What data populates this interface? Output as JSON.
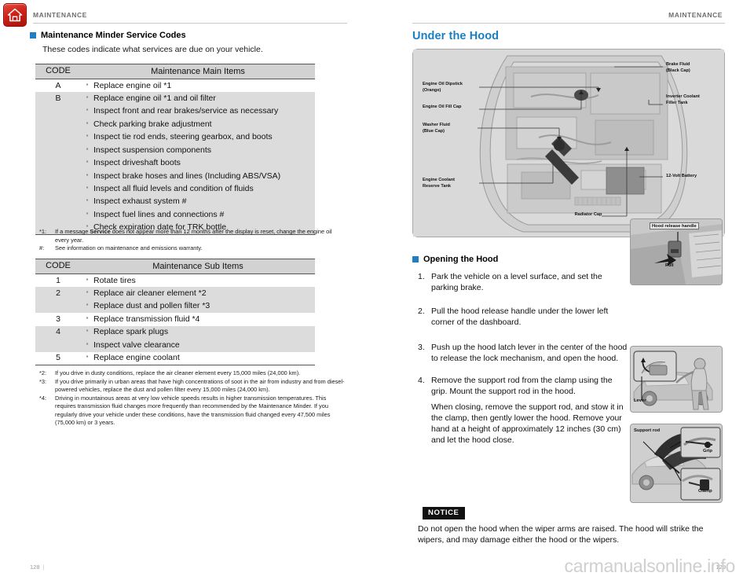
{
  "home_icon": {
    "name": "home-icon"
  },
  "left_page": {
    "running_head": "MAINTENANCE",
    "section_heading": "Maintenance Minder Service Codes",
    "lead": "These codes indicate what services are due on your vehicle.",
    "main_table": {
      "col_code": "CODE",
      "col_items": "Maintenance Main Items",
      "rows": [
        {
          "code": "A",
          "items": [
            "Replace engine oil *1"
          ]
        },
        {
          "code": "B",
          "items": [
            "Replace engine oil *1 and oil filter",
            "Inspect front and rear brakes/service as necessary",
            "Check parking brake adjustment",
            "Inspect tie rod ends, steering gearbox, and boots",
            "Inspect suspension components",
            "Inspect driveshaft boots",
            "Inspect brake hoses and lines (Including ABS/VSA)",
            "Inspect all fluid levels and condition of fluids",
            "Inspect exhaust system #",
            "Inspect fuel lines and connections #",
            "Check expiration date for TRK bottle"
          ]
        }
      ]
    },
    "main_footnotes": [
      {
        "key": "*1:",
        "text_before": "If a message ",
        "bold": "Service",
        "text_after": " does not appear more than 12 months after the display is reset, change the engine oil every year."
      },
      {
        "key": "#:",
        "text_before": "See information on maintenance and emissions warranty.",
        "bold": "",
        "text_after": ""
      }
    ],
    "sub_table": {
      "col_code": "CODE",
      "col_items": "Maintenance Sub Items",
      "rows": [
        {
          "code": "1",
          "items": [
            "Rotate tires"
          ]
        },
        {
          "code": "2",
          "items": [
            "Replace air cleaner element *2",
            "Replace dust and pollen filter  *3"
          ]
        },
        {
          "code": "3",
          "items": [
            "Replace transmission fluid *4"
          ]
        },
        {
          "code": "4",
          "items": [
            "Replace spark plugs",
            "Inspect valve clearance"
          ]
        },
        {
          "code": "5",
          "items": [
            "Replace engine coolant"
          ]
        }
      ]
    },
    "sub_footnotes": [
      {
        "key": "*2:",
        "text": "If you drive in dusty conditions, replace the air cleaner element every 15,000 miles (24,000 km)."
      },
      {
        "key": "*3:",
        "text": "If you drive primarily in urban areas that have high concentrations of soot in the air from industry and from diesel-powered vehicles, replace the dust and pollen filter every 15,000 miles (24,000 km)."
      },
      {
        "key": "*4:",
        "text": "Driving in mountainous areas at very low vehicle speeds results in higher transmission temperatures. This requires transmission fluid changes more frequently than recommended by the Maintenance Minder. If you regularly drive your vehicle under these conditions, have the transmission fluid changed every 47,500 miles (75,000 km) or 3 years."
      }
    ],
    "page_number": "128"
  },
  "right_page": {
    "running_head": "MAINTENANCE",
    "title": "Under the Hood",
    "engine_diagram": {
      "labels_left": [
        "Engine Oil Dipstick\n(Orange)",
        "Engine Oil Fill Cap",
        "Washer Fluid\n(Blue Cap)",
        "Engine Coolant\nReserve Tank"
      ],
      "labels_right": [
        "Brake Fluid\n(Black Cap)",
        "Inverter Coolant\nFiller Tank",
        "12-Volt Battery"
      ],
      "label_bottom": "Radiator Cap"
    },
    "subsection_heading": "Opening the Hood",
    "steps": [
      {
        "num": "1.",
        "text": "Park the vehicle on a level surface, and set the parking brake."
      },
      {
        "num": "2.",
        "text": "Pull the hood release handle under the lower left corner of the dashboard."
      },
      {
        "num": "3.",
        "text": "Push up the hood latch lever in the center of the hood to release the lock mechanism, and open the hood."
      },
      {
        "num": "4.",
        "text": "Remove the support rod from the clamp using the grip. Mount the support rod in the hood."
      }
    ],
    "step4_continuation": "When closing, remove the support rod, and stow it in the clamp, then gently lower the hood. Remove your hand at a height of approximately 12 inches (30 cm) and let the hood close.",
    "photos": [
      {
        "name": "hood-release-handle-photo",
        "captions": [
          "Hood release handle",
          "Pull"
        ]
      },
      {
        "name": "hood-latch-lever-photo",
        "captions": [
          "Lever"
        ]
      },
      {
        "name": "support-rod-photo",
        "captions": [
          "Support rod",
          "Grip",
          "Clamp"
        ]
      }
    ],
    "notice": {
      "tag": "NOTICE",
      "body": "Do not open the hood when the wiper arms are raised. The hood will strike the wipers, and may damage either the hood or the wipers."
    },
    "page_number": "129"
  },
  "watermark": "carmanualsonline.info",
  "colors": {
    "accent_blue": "#1a7fc1",
    "bullet_blue": "#1f7ec4",
    "home_red": "#cf2118",
    "table_header_gray": "#d2d2d2",
    "table_shade_gray": "#dcdcdc"
  }
}
